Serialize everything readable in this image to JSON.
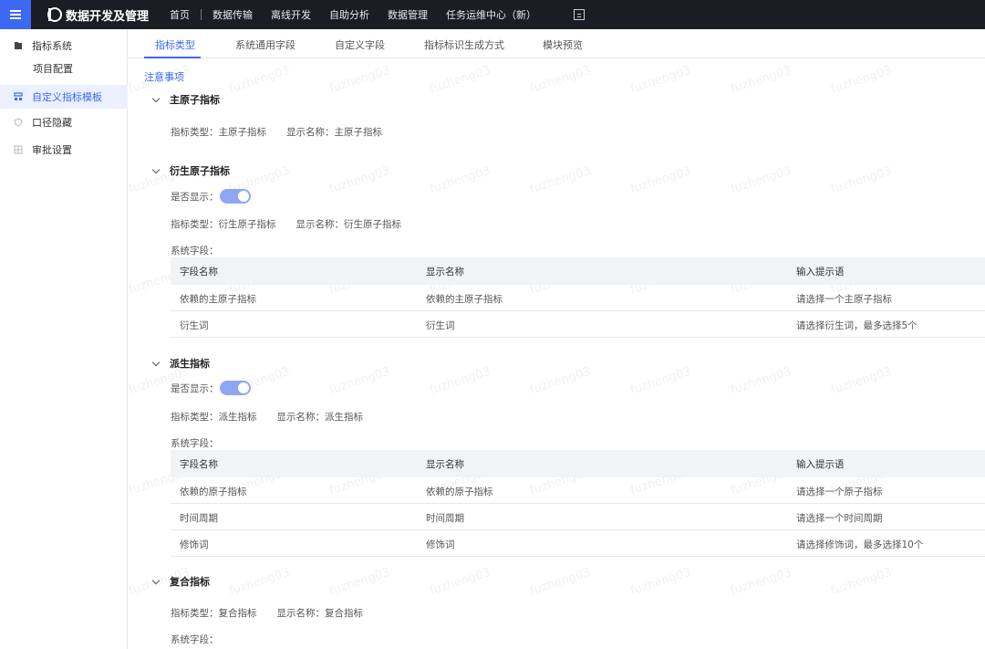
{
  "app": {
    "title": "数据开发及管理"
  },
  "nav": {
    "items": [
      "首页",
      "数据传输",
      "离线开发",
      "自助分析",
      "数据管理",
      "任务运维中心（新）"
    ]
  },
  "sidebar": {
    "items": [
      {
        "label": "指标系统"
      },
      {
        "label": "项目配置"
      },
      {
        "label": "自定义指标模板"
      },
      {
        "label": "口径隐藏"
      },
      {
        "label": "审批设置"
      }
    ]
  },
  "tabs": [
    "指标类型",
    "系统通用字段",
    "自定义字段",
    "指标标识生成方式",
    "模块预览"
  ],
  "notice": "注意事项",
  "labels": {
    "show": "是否显示：",
    "sys_fields": "系统字段：",
    "type_prefix": "指标类型：",
    "name_prefix": "显示名称："
  },
  "table_headers": [
    "字段名称",
    "显示名称",
    "输入提示语"
  ],
  "sections": [
    {
      "title": "主原子指标",
      "type_line": "指标类型：主原子指标",
      "name_line": "显示名称：主原子指标"
    },
    {
      "title": "衍生原子指标",
      "type_line": "指标类型：衍生原子指标",
      "name_line": "显示名称：衍生原子指标",
      "rows": [
        [
          "依赖的主原子指标",
          "依赖的主原子指标",
          "请选择一个主原子指标"
        ],
        [
          "衍生词",
          "衍生词",
          "请选择衍生词，最多选择5个"
        ]
      ]
    },
    {
      "title": "派生指标",
      "type_line": "指标类型：派生指标",
      "name_line": "显示名称：派生指标",
      "rows": [
        [
          "依赖的原子指标",
          "依赖的原子指标",
          "请选择一个原子指标"
        ],
        [
          "时间周期",
          "时间周期",
          "请选择一个时间周期"
        ],
        [
          "修饰词",
          "修饰词",
          "请选择修饰词，最多选择10个"
        ]
      ]
    },
    {
      "title": "复合指标",
      "type_line": "指标类型：复合指标",
      "name_line": "显示名称：复合指标"
    }
  ],
  "watermark": "fuzheng03",
  "colors": {
    "accent": "#3d68f5",
    "topbar": "#1a1d24",
    "toggle_on": "#8fa7f3"
  }
}
